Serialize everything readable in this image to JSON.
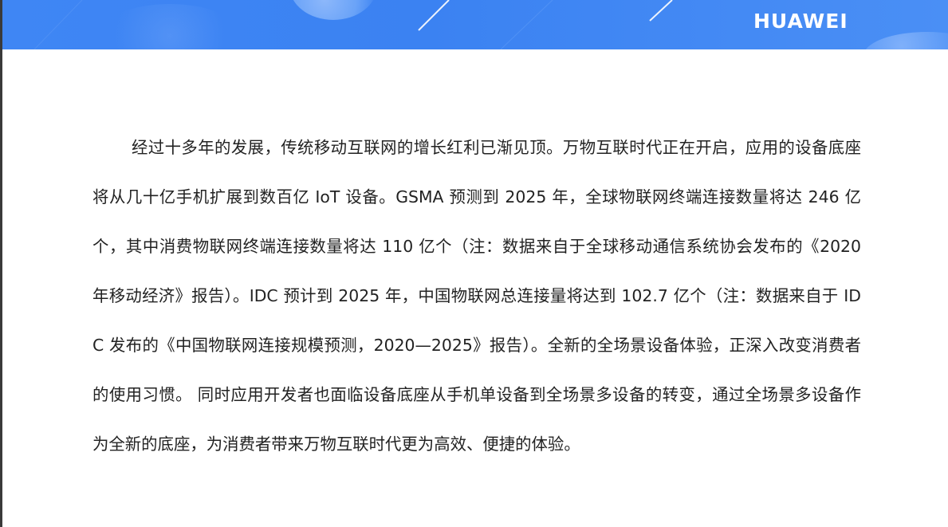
{
  "header": {
    "brand": "HUAWEI"
  },
  "content": {
    "paragraph": "经过十多年的发展，传统移动互联网的增长红利已渐见顶。万物互联时代正在开启，应用的设备底座将从几十亿手机扩展到数百亿 IoT 设备。GSMA 预测到 2025 年，全球物联网终端连接数量将达 246 亿个，其中消费物联网终端连接数量将达 110 亿个（注：数据来自于全球移动通信系统协会发布的《2020 年移动经济》报告）。IDC 预计到 2025 年，中国物联网总连接量将达到 102.7 亿个（注：数据来自于 IDC 发布的《中国物联网连接规模预测，2020—2025》报告）。全新的全场景设备体验，正深入改变消费者的使用习惯。 同时应用开发者也面临设备底座从手机单设备到全场景多设备的转变，通过全场景多设备作为全新的底座，为消费者带来万物互联时代更为高效、便捷的体验。"
  }
}
